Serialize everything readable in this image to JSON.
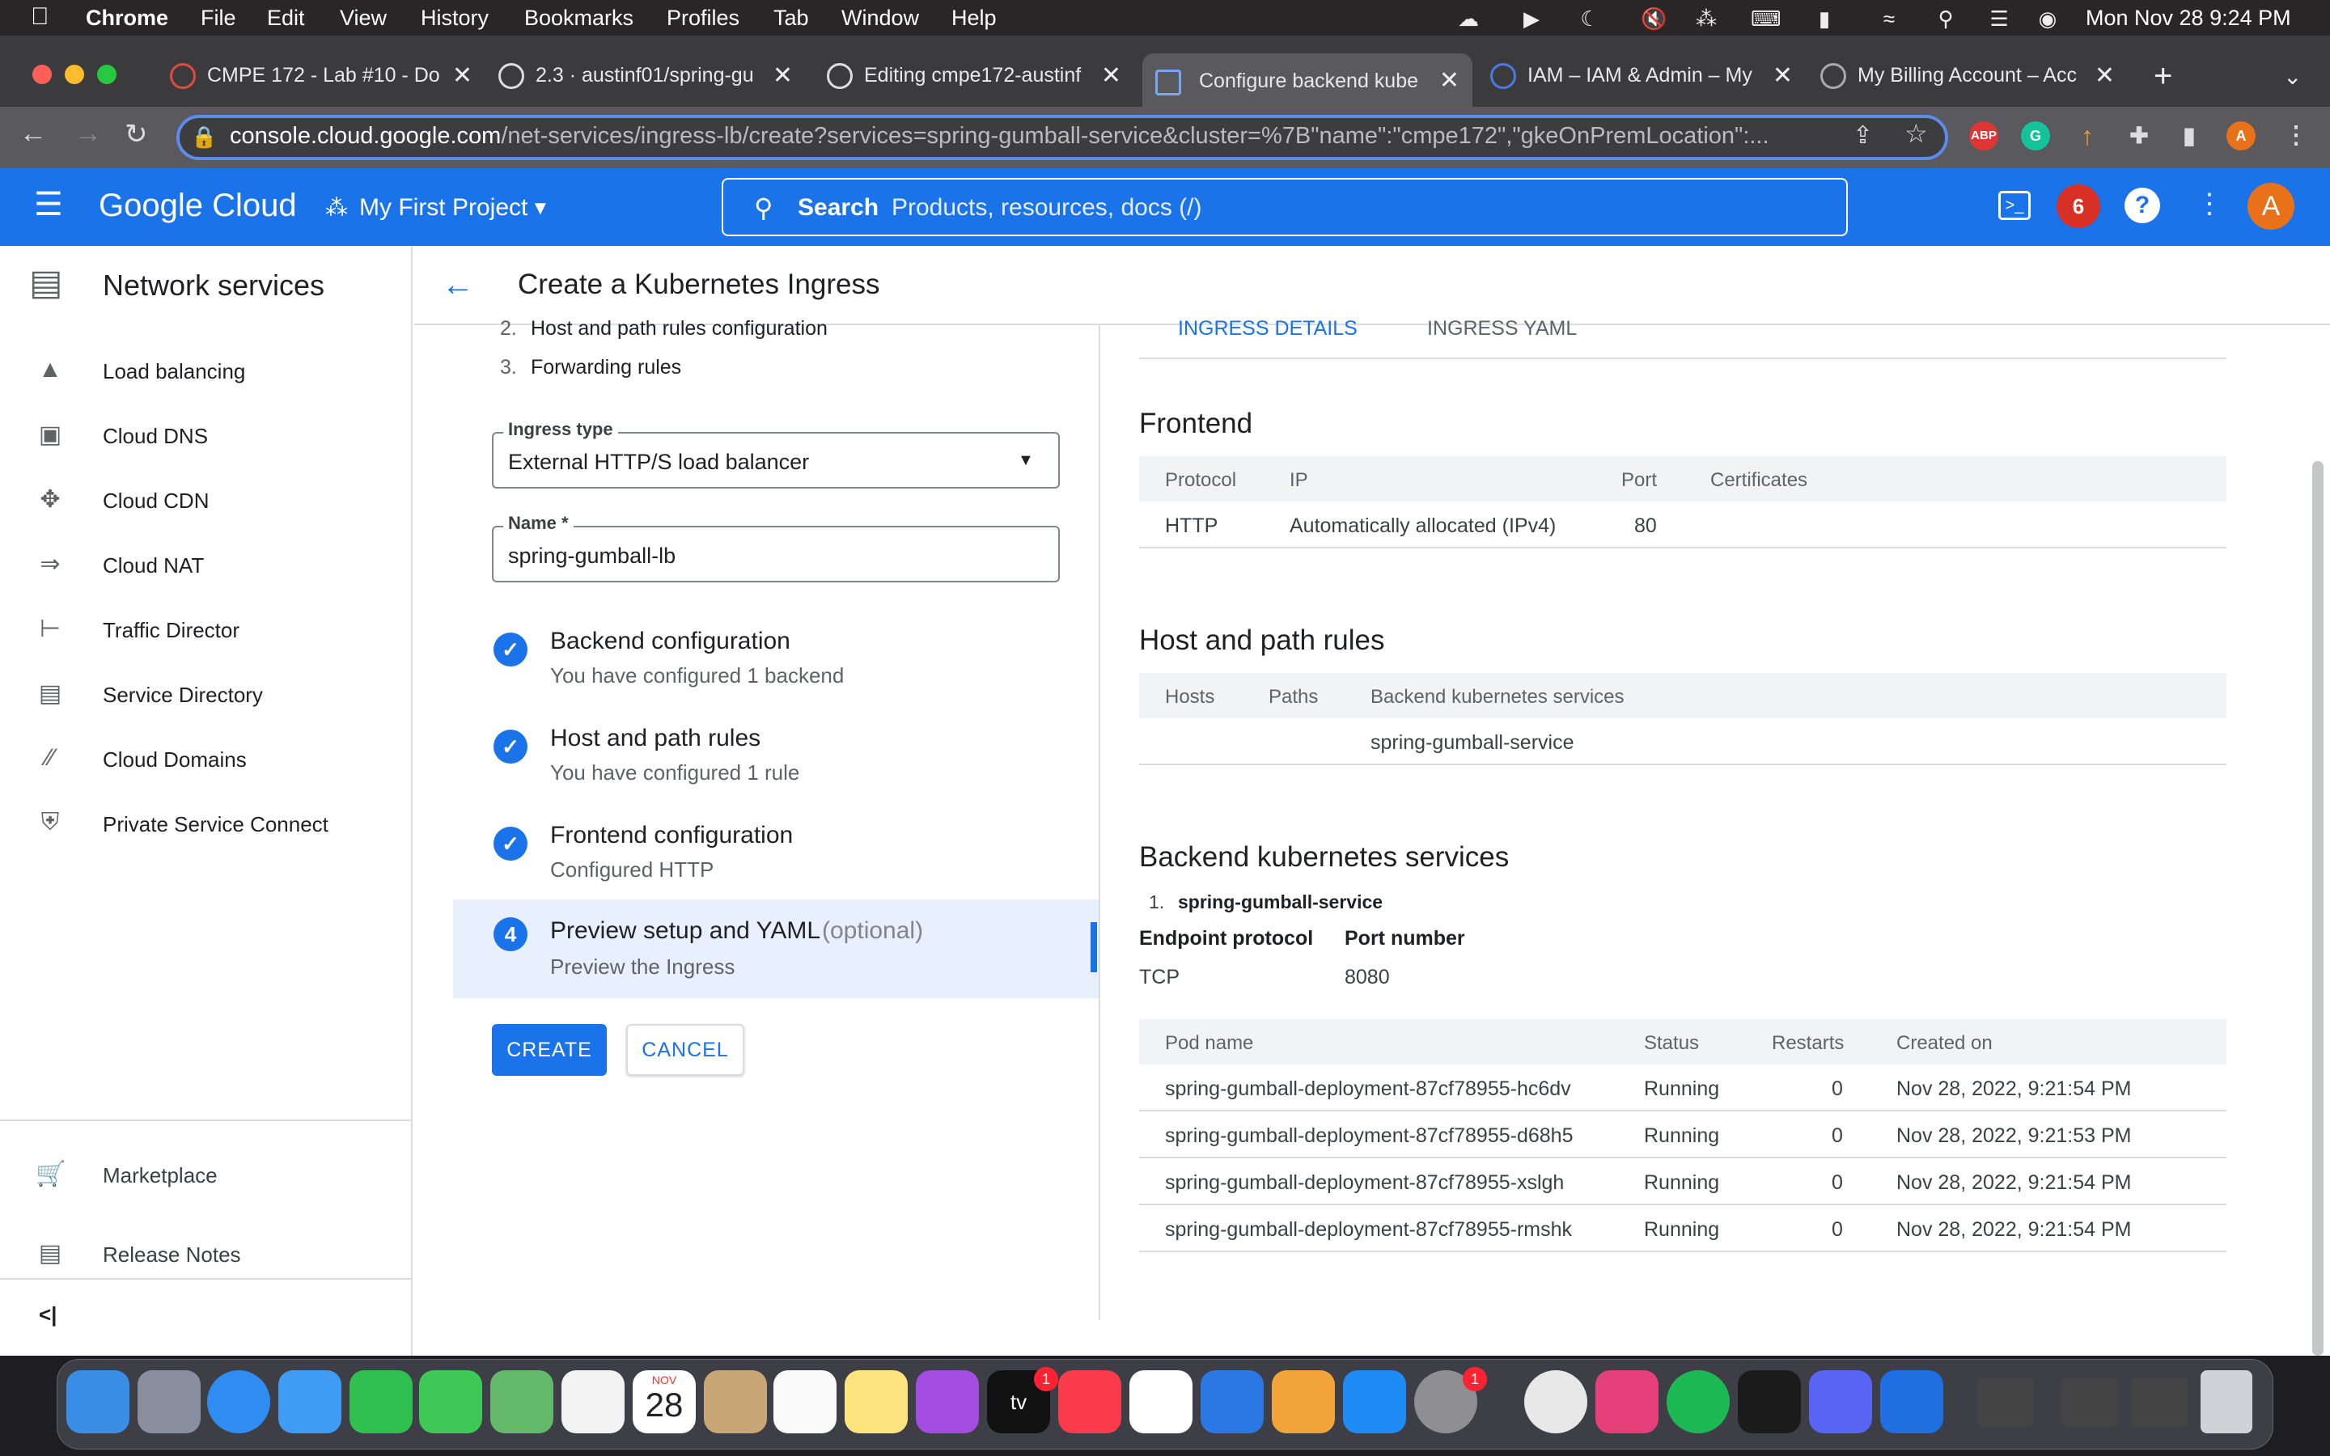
{
  "menubar": {
    "app": "Chrome",
    "items": [
      "File",
      "Edit",
      "View",
      "History",
      "Bookmarks",
      "Profiles",
      "Tab",
      "Window",
      "Help"
    ],
    "clock": "Mon Nov 28  9:24 PM"
  },
  "tabs": [
    {
      "title": "CMPE 172 - Lab #10 - Do"
    },
    {
      "title": "2.3 · austinf01/spring-gu"
    },
    {
      "title": "Editing cmpe172-austinf"
    },
    {
      "title": "Configure backend kube"
    },
    {
      "title": "IAM – IAM & Admin – My"
    },
    {
      "title": "My Billing Account – Acc"
    }
  ],
  "url": {
    "host": "console.cloud.google.com",
    "path": "/net-services/ingress-lb/create?services=spring-gumball-service&cluster=%7B\"name\":\"cmpe172\",\"gkeOnPremLocation\":..."
  },
  "extensions": {
    "abp": "ABP",
    "avatar": "A"
  },
  "gc": {
    "logo": "Google Cloud",
    "project": "My First Project",
    "search_label": "Search",
    "search_placeholder": "Products, resources, docs (/)",
    "notif_count": "6",
    "avatar": "A"
  },
  "sidebar": {
    "title": "Network services",
    "items": [
      "Load balancing",
      "Cloud DNS",
      "Cloud CDN",
      "Cloud NAT",
      "Traffic Director",
      "Service Directory",
      "Cloud Domains",
      "Private Service Connect"
    ],
    "bottom": [
      "Marketplace",
      "Release Notes"
    ],
    "collapse": "<|"
  },
  "page": {
    "title": "Create a Kubernetes Ingress"
  },
  "left": {
    "toc": [
      {
        "n": "2.",
        "t": "Host and path rules configuration"
      },
      {
        "n": "3.",
        "t": "Forwarding rules"
      }
    ],
    "ingress_type": {
      "label": "Ingress type",
      "value": "External HTTP/S load balancer"
    },
    "name": {
      "label": "Name *",
      "value": "spring-gumball-lb"
    },
    "steps": [
      {
        "title": "Backend configuration",
        "sub": "You have configured 1 backend"
      },
      {
        "title": "Host and path rules",
        "sub": "You have configured 1 rule"
      },
      {
        "title": "Frontend configuration",
        "sub": "Configured HTTP"
      },
      {
        "num": "4",
        "title": "Preview setup and YAML",
        "opt": "(optional)",
        "sub": "Preview the Ingress"
      }
    ],
    "create": "CREATE",
    "cancel": "CANCEL"
  },
  "right": {
    "tabs": [
      "INGRESS DETAILS",
      "INGRESS YAML"
    ],
    "frontend": {
      "title": "Frontend",
      "headers": [
        "Protocol",
        "IP",
        "Port",
        "Certificates"
      ],
      "row": [
        "HTTP",
        "Automatically allocated (IPv4)",
        "80",
        ""
      ]
    },
    "hostpath": {
      "title": "Host and path rules",
      "headers": [
        "Hosts",
        "Paths",
        "Backend kubernetes services"
      ],
      "row": [
        "",
        "",
        "spring-gumball-service"
      ]
    },
    "backend": {
      "title": "Backend kubernetes services",
      "item_num": "1.",
      "item": "spring-gumball-service",
      "ep_label": "Endpoint protocol",
      "port_label": "Port number",
      "ep": "TCP",
      "port": "8080"
    },
    "pods": {
      "headers": [
        "Pod name",
        "Status",
        "Restarts",
        "Created on"
      ],
      "rows": [
        [
          "spring-gumball-deployment-87cf78955-hc6dv",
          "Running",
          "0",
          "Nov 28, 2022, 9:21:54 PM"
        ],
        [
          "spring-gumball-deployment-87cf78955-d68h5",
          "Running",
          "0",
          "Nov 28, 2022, 9:21:53 PM"
        ],
        [
          "spring-gumball-deployment-87cf78955-xslgh",
          "Running",
          "0",
          "Nov 28, 2022, 9:21:54 PM"
        ],
        [
          "spring-gumball-deployment-87cf78955-rmshk",
          "Running",
          "0",
          "Nov 28, 2022, 9:21:54 PM"
        ]
      ]
    }
  },
  "dock": {
    "calendar_month": "NOV",
    "calendar_day": "28",
    "badge_tv": "1",
    "badge_settings": "1",
    "tv_label": "tv"
  },
  "colors": {
    "accent": "#1a73e8",
    "menubar": "#2a2527",
    "tabbar": "#3b3b3e"
  }
}
